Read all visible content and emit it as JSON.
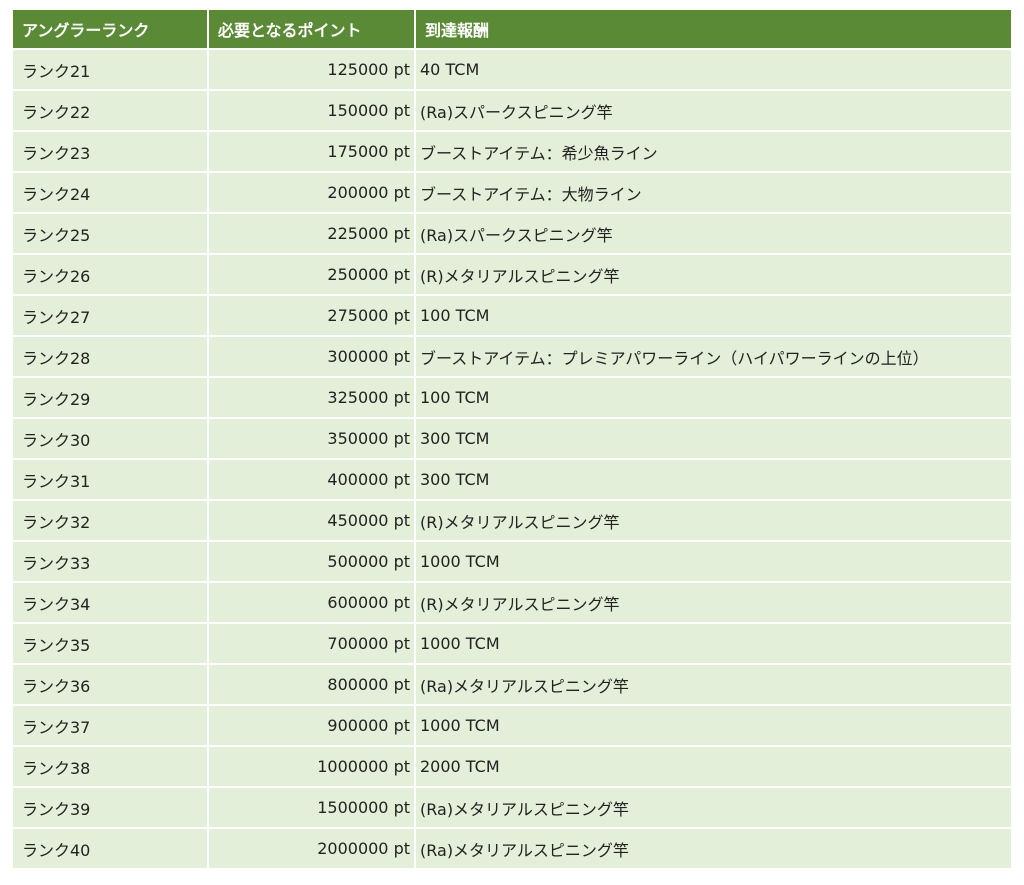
{
  "header": {
    "col_rank": "アングラーランク",
    "col_points": "必要となるポイント",
    "col_reward": "到達報酬"
  },
  "rows": [
    {
      "rank": "ランク21",
      "points": "125000 pt",
      "reward": "40 TCM"
    },
    {
      "rank": "ランク22",
      "points": "150000 pt",
      "reward": "(Ra)スパークスピニング竿"
    },
    {
      "rank": "ランク23",
      "points": "175000 pt",
      "reward": "ブーストアイテム：希少魚ライン"
    },
    {
      "rank": "ランク24",
      "points": "200000 pt",
      "reward": "ブーストアイテム：大物ライン"
    },
    {
      "rank": "ランク25",
      "points": "225000 pt",
      "reward": "(Ra)スパークスピニング竿"
    },
    {
      "rank": "ランク26",
      "points": "250000 pt",
      "reward": "(R)メタリアルスピニング竿"
    },
    {
      "rank": "ランク27",
      "points": "275000 pt",
      "reward": "100 TCM"
    },
    {
      "rank": "ランク28",
      "points": "300000 pt",
      "reward": "ブーストアイテム：プレミアパワーライン（ハイパワーラインの上位）"
    },
    {
      "rank": "ランク29",
      "points": "325000 pt",
      "reward": "100 TCM"
    },
    {
      "rank": "ランク30",
      "points": "350000 pt",
      "reward": "300 TCM"
    },
    {
      "rank": "ランク31",
      "points": "400000 pt",
      "reward": "300 TCM"
    },
    {
      "rank": "ランク32",
      "points": "450000 pt",
      "reward": "(R)メタリアルスピニング竿"
    },
    {
      "rank": "ランク33",
      "points": "500000 pt",
      "reward": "1000 TCM"
    },
    {
      "rank": "ランク34",
      "points": "600000 pt",
      "reward": "(R)メタリアルスピニング竿"
    },
    {
      "rank": "ランク35",
      "points": "700000 pt",
      "reward": "1000 TCM"
    },
    {
      "rank": "ランク36",
      "points": "800000 pt",
      "reward": "(Ra)メタリアルスピニング竿"
    },
    {
      "rank": "ランク37",
      "points": "900000 pt",
      "reward": "1000 TCM"
    },
    {
      "rank": "ランク38",
      "points": "1000000 pt",
      "reward": "2000 TCM"
    },
    {
      "rank": "ランク39",
      "points": "1500000 pt",
      "reward": "(Ra)メタリアルスピニング竿"
    },
    {
      "rank": "ランク40",
      "points": "2000000 pt",
      "reward": "(Ra)メタリアルスピニング竿"
    }
  ],
  "colors": {
    "header_bg": "#5a8a36",
    "row_bg": "#e3efd8"
  }
}
